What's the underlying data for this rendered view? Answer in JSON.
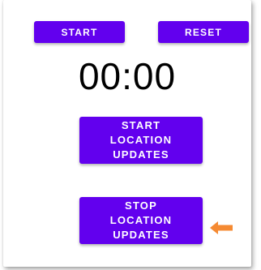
{
  "buttons": {
    "start": "START",
    "reset": "RESET",
    "start_location_updates": "START\nLOCATION\nUPDATES",
    "stop_location_updates": "STOP\nLOCATION\nUPDATES"
  },
  "timer": {
    "value": "00:00"
  },
  "colors": {
    "button_bg": "#6200ee",
    "button_text": "#ffffff",
    "arrow": "#f58a32"
  },
  "icons": {
    "pointer_arrow": "left-arrow-icon"
  }
}
